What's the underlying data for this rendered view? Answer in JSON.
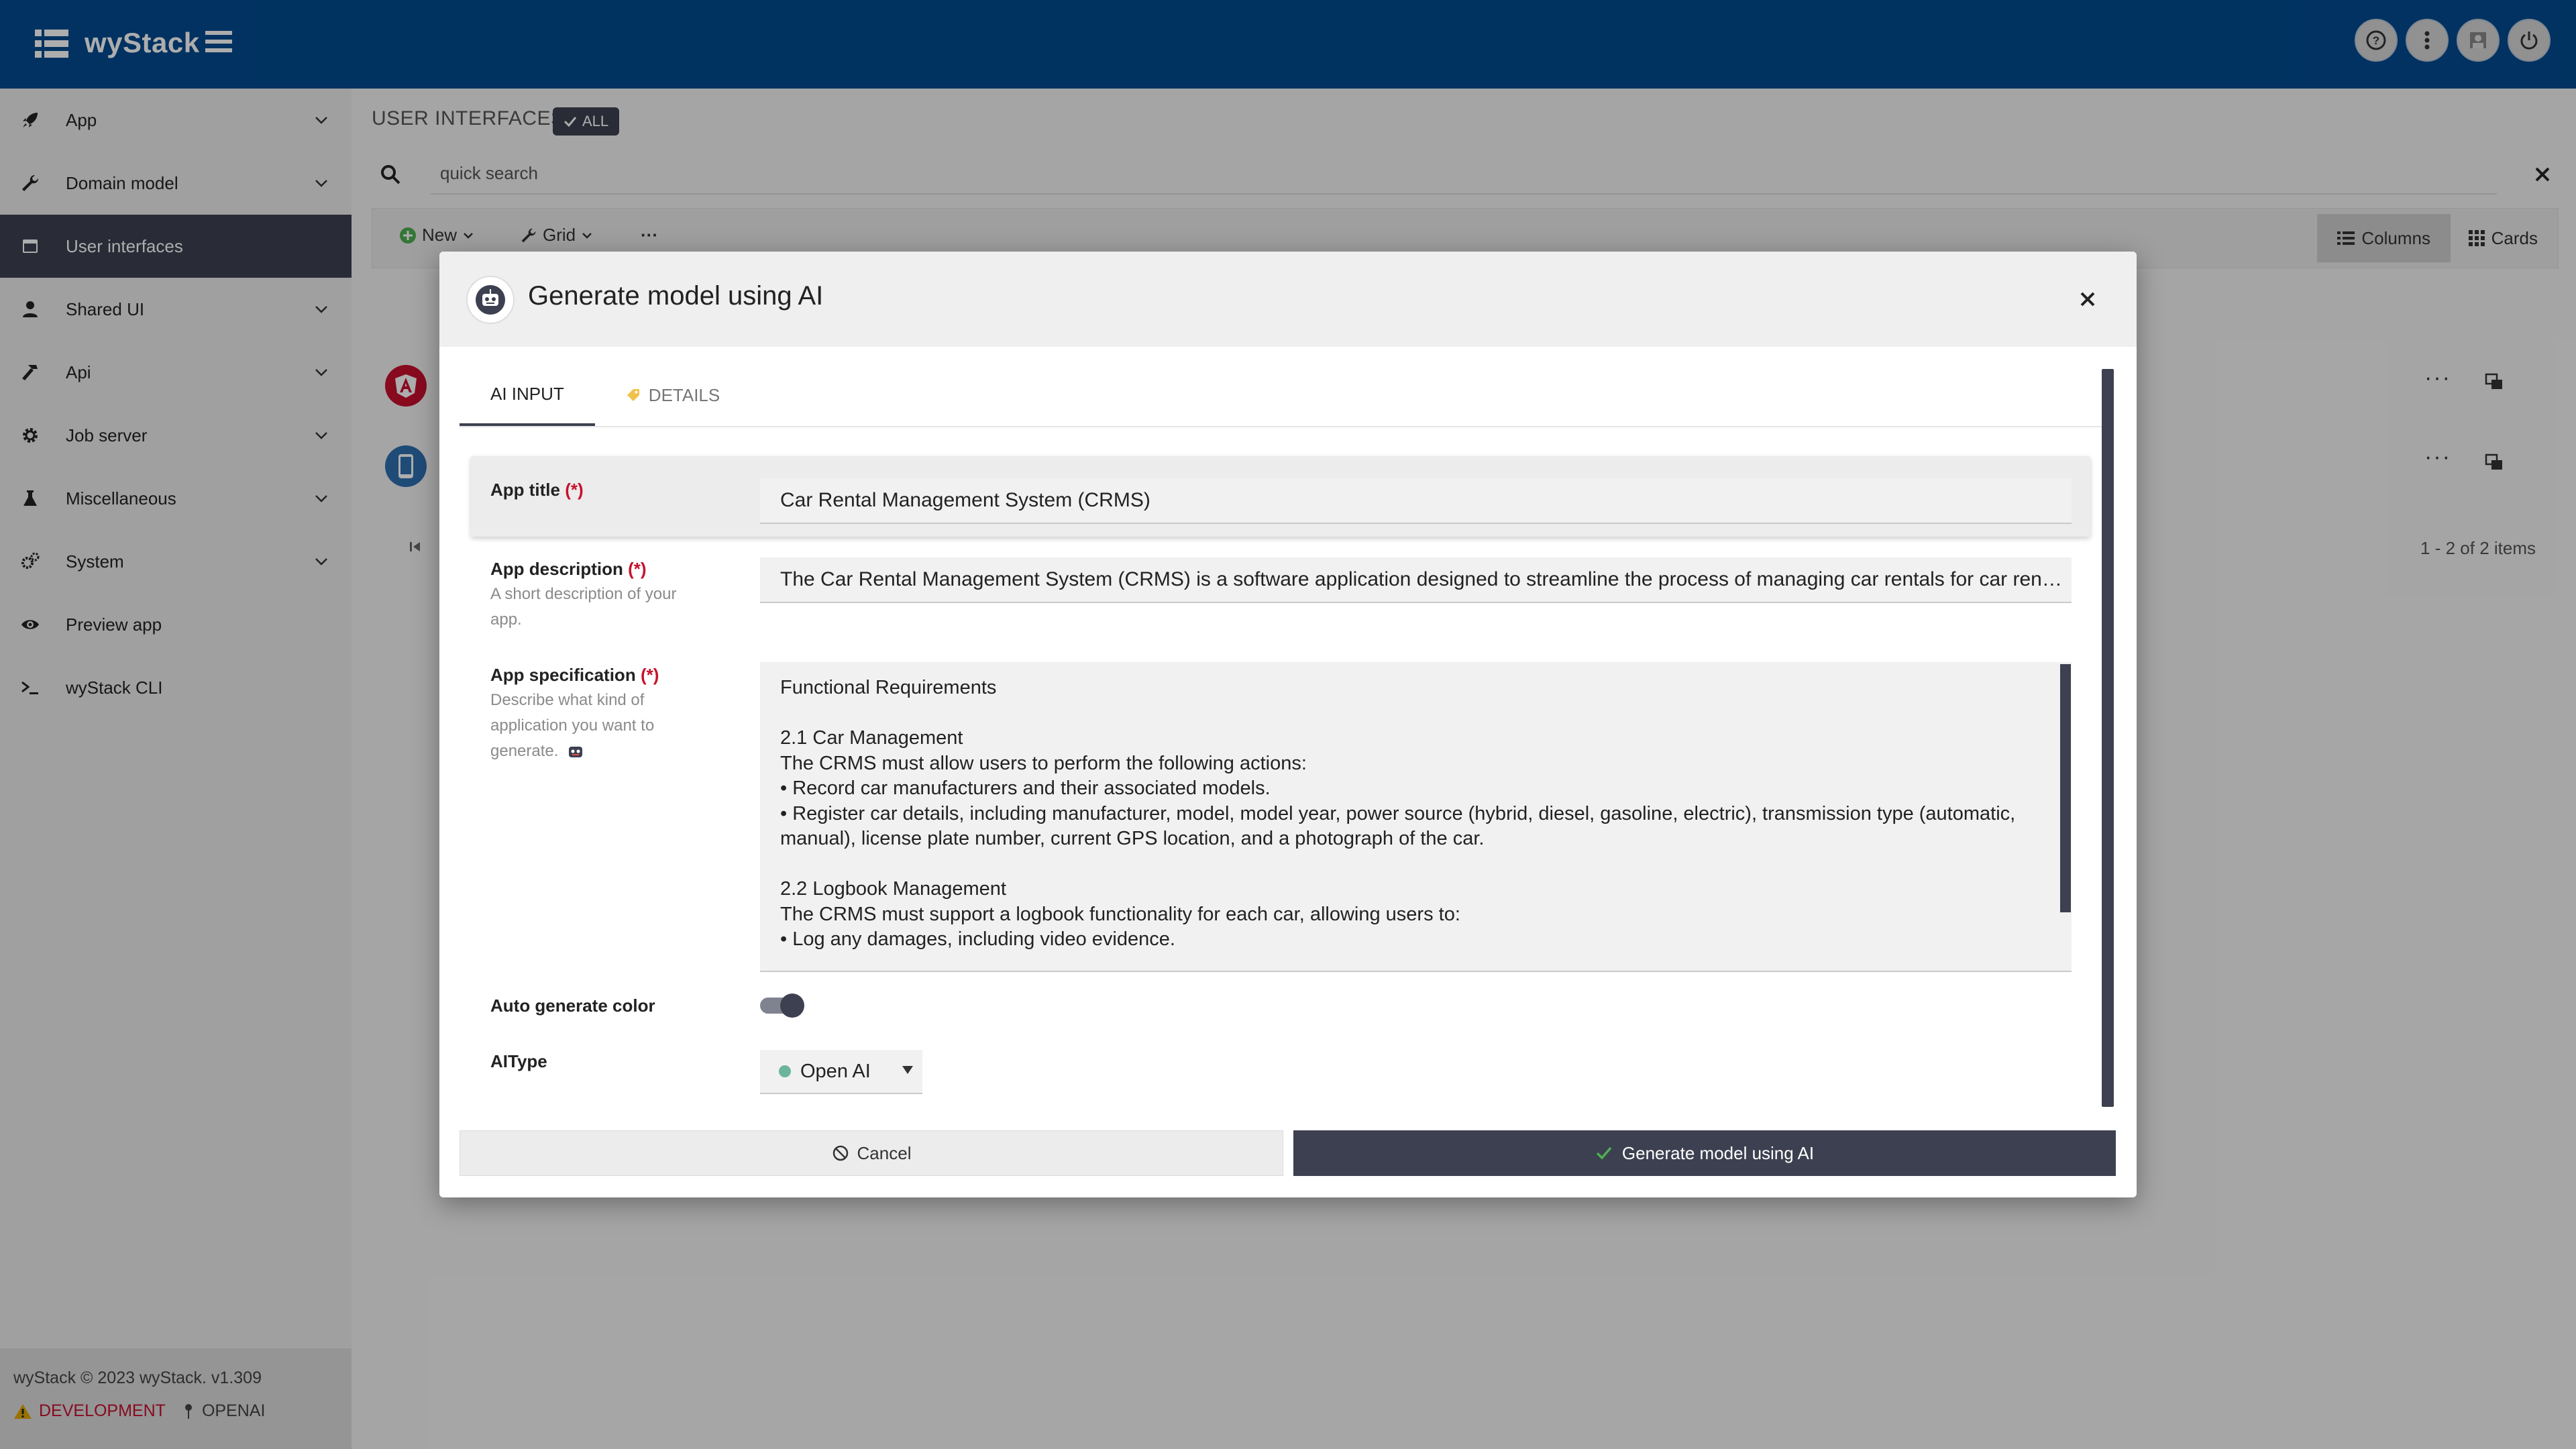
{
  "app": {
    "brand": "wyStack"
  },
  "colors": {
    "topbar": "#024b8f",
    "accent_dark": "#3d4050",
    "required": "#c8102e",
    "success": "#4caf50"
  },
  "top_actions": [
    "help-icon",
    "more-vertical-icon",
    "user-icon",
    "power-icon"
  ],
  "sidebar": {
    "items": [
      {
        "label": "App",
        "icon": "rocket-icon",
        "expandable": true
      },
      {
        "label": "Domain model",
        "icon": "wrench-icon",
        "expandable": true
      },
      {
        "label": "User interfaces",
        "icon": "window-icon",
        "expandable": false,
        "active": true
      },
      {
        "label": "Shared UI",
        "icon": "person-icon",
        "expandable": true
      },
      {
        "label": "Api",
        "icon": "hammer-icon",
        "expandable": true
      },
      {
        "label": "Job server",
        "icon": "gear-icon",
        "expandable": true
      },
      {
        "label": "Miscellaneous",
        "icon": "flask-icon",
        "expandable": true
      },
      {
        "label": "System",
        "icon": "gears-icon",
        "expandable": true
      },
      {
        "label": "Preview app",
        "icon": "eye-icon",
        "expandable": false
      },
      {
        "label": "wyStack CLI",
        "icon": "terminal-icon",
        "expandable": false
      }
    ],
    "footer": {
      "copyright": "wyStack © 2023 wyStack. v1.309",
      "env": "DEVELOPMENT",
      "provider": "OPENAI"
    }
  },
  "page": {
    "heading": "USER INTERFACES",
    "filter_badge": "ALL",
    "search": {
      "placeholder": "quick search",
      "value": "quick search"
    },
    "toolbar": {
      "new_label": "New",
      "grid_label": "Grid",
      "more_label": "···",
      "columns_label": "Columns",
      "cards_label": "Cards"
    },
    "rows_menu": "···",
    "pager": "1 - 2 of 2 items"
  },
  "dialog": {
    "title": "Generate model using AI",
    "tabs": [
      {
        "label": "AI INPUT",
        "active": true
      },
      {
        "label": "DETAILS",
        "active": false
      }
    ],
    "fields": {
      "app_title": {
        "label": "App title",
        "required_mark": "(*)",
        "value": "Car Rental Management System (CRMS)"
      },
      "app_description": {
        "label": "App description",
        "required_mark": "(*)",
        "help": "A short description of your app.",
        "value": "The Car Rental Management System (CRMS) is a software application designed to streamline the process of managing car rentals for car ren…"
      },
      "app_specification": {
        "label": "App specification",
        "required_mark": "(*)",
        "help": "Describe what kind of application you want to generate.",
        "value": "Functional Requirements\n\n2.1 Car Management\nThe CRMS must allow users to perform the following actions:\n• Record car manufacturers and their associated models.\n• Register car details, including manufacturer, model, model year, power source (hybrid, diesel, gasoline, electric), transmission type (automatic,\nmanual), license plate number, current GPS location, and a photograph of the car.\n\n2.2 Logbook Management\nThe CRMS must support a logbook functionality for each car, allowing users to:\n• Log any damages, including video evidence."
      },
      "auto_color": {
        "label": "Auto generate color",
        "checked": true
      },
      "ai_type": {
        "label": "AIType",
        "value": "Open AI"
      }
    },
    "buttons": {
      "cancel": "Cancel",
      "generate": "Generate model using AI"
    }
  }
}
